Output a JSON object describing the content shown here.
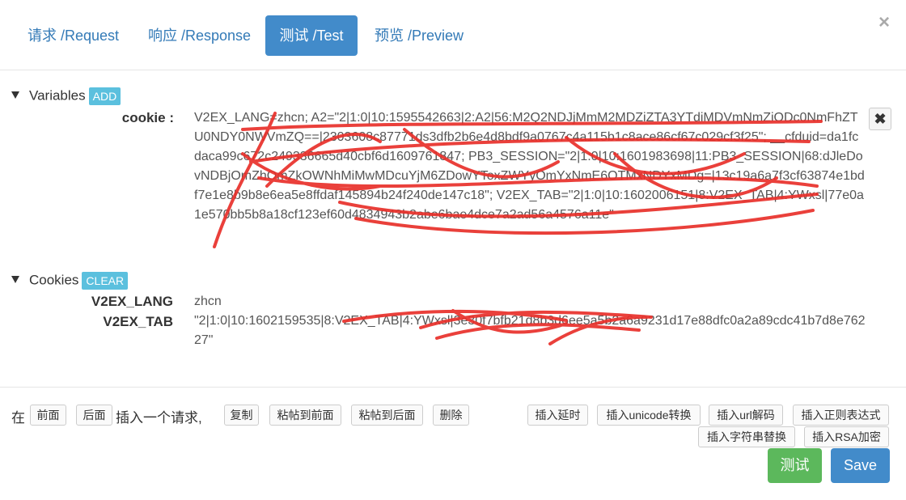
{
  "tabs": [
    {
      "label": "请求 /Request"
    },
    {
      "label": "响应 /Response"
    },
    {
      "label": "测试 /Test"
    },
    {
      "label": "预览 /Preview"
    }
  ],
  "close_label": "×",
  "variables": {
    "heading": "Variables",
    "add_label": "ADD",
    "key": "cookie :",
    "value": "V2EX_LANG=zhcn; A2=\"2|1:0|10:1595542663|2:A2|56:M2Q2NDJjMmM2MDZiZTA3YTdiMDVmNmZiODc0NmFhZTU0NDY0NWVmZQ==|2303608c87771ds3dfb2b6e4d8bdf9a0767c4a115b1c8ace86cf67c029cf3f25\"; __cfduid=da1fcdaca99c672c249336665d40cbf6d1609761847; PB3_SESSION=\"2|1:0|10:1601983698|11:PB3_SESSION|68:dJleDovNDBjOmZhOmZkOWNhMiMwMDcuYjM6ZDowYToxZWYyOmYxNmE6OTMxNDYxMDg=|13c19a6a7f3cf63874e1bdf7e1e8b9b8e6ea5e8ffdaf145894b24f240de147c18\"; V2EX_TAB=\"2|1:0|10:1602006151|8:V2EX_TAB|4:YWxsl|77e0a1e570bb5b8a18cf123ef60d4834943b2abe6bae4dce7a2ad56a4576a11e\"",
    "delete_icon_label": "✖"
  },
  "cookies": {
    "heading": "Cookies",
    "clear_label": "CLEAR",
    "items": [
      {
        "key": "V2EX_LANG",
        "value": "zhcn"
      },
      {
        "key": "V2EX_TAB",
        "value": "\"2|1:0|10:1602159535|8:V2EX_TAB|4:YWxsl|3e30f7bfb21d8b3d6ee5a5b2a6a9231d17e88dfc0a2a89cdc41b7d8e76227\""
      }
    ]
  },
  "toolbar": {
    "prefix": "在",
    "before_label": "前面",
    "after_label": "后面",
    "insert_text": "插入一个请求,",
    "copy_label": "复制",
    "paste_before_label": "粘帖到前面",
    "paste_after_label": "粘帖到后面",
    "delete_label": "删除",
    "insert_delay_label": "插入延时",
    "insert_unicode_label": "插入unicode转换",
    "insert_url_label": "插入url解码",
    "insert_regex_label": "插入正则表达式",
    "insert_replace_label": "插入字符串替换",
    "insert_rsa_label": "插入RSA加密"
  },
  "actions": {
    "test_label": "测试",
    "save_label": "Save"
  },
  "colors": {
    "primary": "#428bca",
    "success": "#5cb85c",
    "info": "#5bc0de",
    "redaction": "#e8302a"
  }
}
